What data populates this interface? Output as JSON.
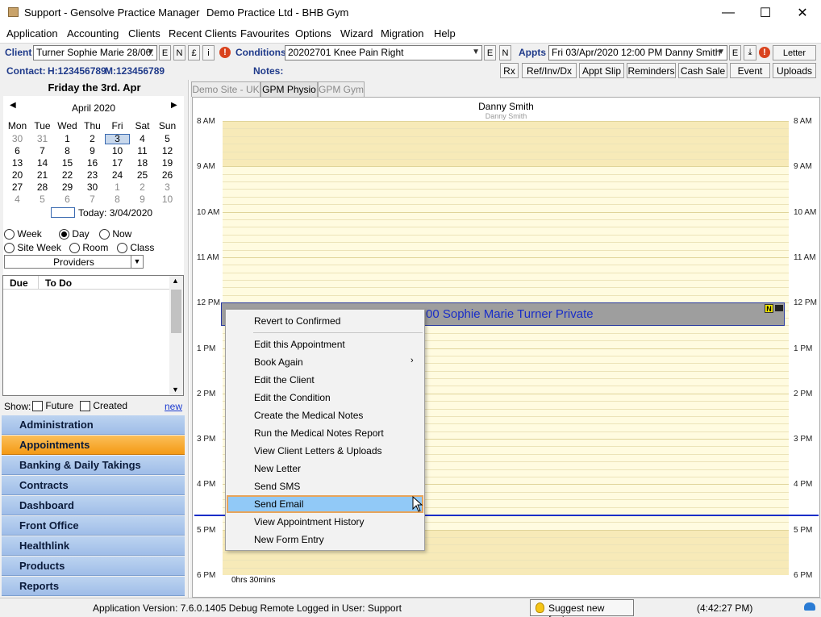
{
  "window": {
    "title": "Support - Gensolve Practice Manager",
    "practice": "Demo Practice Ltd - BHB Gym",
    "minimize": "—",
    "maximize": "☐",
    "close": "✕"
  },
  "menu": [
    "Application",
    "Accounting",
    "Clients",
    "Recent Clients",
    "Favourites",
    "Options",
    "Wizard",
    "Migration",
    "Help"
  ],
  "toolbar": {
    "client_label": "Client",
    "client_value": "Turner Sophie Marie 28/06.",
    "client_buttons": [
      "E",
      "N",
      "£",
      "i"
    ],
    "conditions_label": "Conditions",
    "conditions_value": "20202701 Knee Pain Right",
    "conditions_buttons": [
      "E",
      "N"
    ],
    "appts_label": "Appts",
    "appts_value": "Fri 03/Apr/2020  12:00 PM Danny Smith",
    "appts_button": "E",
    "letter_button": "Letter",
    "alert": "!",
    "contact_label": "Contact:",
    "contact_home": "H:123456789",
    "contact_mobile": "M:123456789",
    "notes_label": "Notes:",
    "actions": [
      "Rx",
      "Ref/Inv/Dx",
      "Appt Slip",
      "Reminders",
      "Cash Sale",
      "Event",
      "Uploads"
    ]
  },
  "calendar": {
    "heading": "Friday the 3rd. Apr",
    "month": "April 2020",
    "prev": "◀",
    "next": "▶",
    "weekdays": [
      "Mon",
      "Tue",
      "Wed",
      "Thu",
      "Fri",
      "Sat",
      "Sun"
    ],
    "weeks": [
      [
        "30",
        "31",
        "1",
        "2",
        "3",
        "4",
        "5"
      ],
      [
        "6",
        "7",
        "8",
        "9",
        "10",
        "11",
        "12"
      ],
      [
        "13",
        "14",
        "15",
        "16",
        "17",
        "18",
        "19"
      ],
      [
        "20",
        "21",
        "22",
        "23",
        "24",
        "25",
        "26"
      ],
      [
        "27",
        "28",
        "29",
        "30",
        "1",
        "2",
        "3"
      ],
      [
        "4",
        "5",
        "6",
        "7",
        "8",
        "9",
        "10"
      ]
    ],
    "today_label": "Today: 3/04/2020"
  },
  "view_options": [
    "Week",
    "Day",
    "Now",
    "Site Week",
    "Room",
    "Class"
  ],
  "view_selected": "Day",
  "providers_label": "Providers",
  "todo": {
    "columns": [
      "Due",
      "To Do"
    ],
    "show_label": "Show:",
    "future_label": "Future",
    "created_label": "Created",
    "new_link": "new"
  },
  "nav": [
    "Administration",
    "Appointments",
    "Banking & Daily Takings",
    "Contracts",
    "Dashboard",
    "Front Office",
    "Healthlink",
    "Products",
    "Reports"
  ],
  "nav_active": "Appointments",
  "tabs": [
    "Demo Site - UK",
    "GPM Physio",
    "GPM Gym"
  ],
  "tab_active": "GPM Physio",
  "schedule": {
    "provider": "Danny Smith",
    "provider_sub": "Danny Smith",
    "hours": [
      "8 AM",
      "9 AM",
      "10 AM",
      "11 AM",
      "12 PM",
      "1 PM",
      "2 PM",
      "3 PM",
      "4 PM",
      "5 PM",
      "6 PM"
    ],
    "footer": "0hrs 30mins",
    "appointment_text": "00 Sophie Marie Turner Private",
    "appointment_badge": "N"
  },
  "context_menu": [
    "Revert to Confirmed",
    "Edit this Appointment",
    "Book Again",
    "Edit the Client",
    "Edit the Condition",
    "Create the Medical Notes",
    "Run the Medical Notes Report",
    "View Client Letters & Uploads",
    "New Letter",
    "Send SMS",
    "Send Email",
    "View Appointment History",
    "New Form Entry"
  ],
  "context_highlight": "Send Email",
  "status": {
    "version": "Application Version: 7.6.0.1405 Debug Remote  Logged in User: Support",
    "suggest": "Suggest new feature",
    "time": "(4:42:27 PM)"
  },
  "colors": {
    "accent": "#1f3a8a",
    "nav_blue": "#9fbde8",
    "nav_active": "#f49a14",
    "schedule_bg": "#fffbe0",
    "now_line": "#1a2ec8",
    "highlight": "#91c9f7"
  }
}
